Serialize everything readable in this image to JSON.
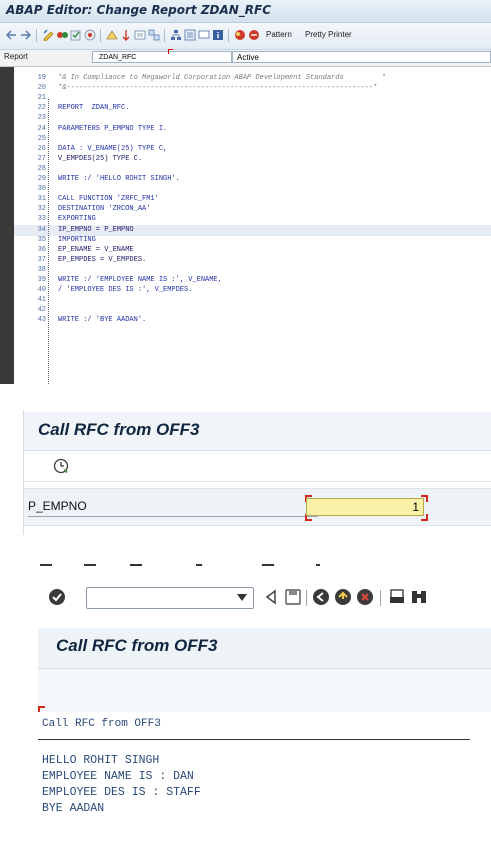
{
  "editor": {
    "title": "ABAP Editor: Change Report ZDAN_RFC",
    "toolbar": {
      "pattern_label": "Pattern",
      "pretty_printer_label": "Pretty Printer"
    },
    "report_label": "Report",
    "report_value": "ZDAN_RFC",
    "status": "Active",
    "lines": [
      {
        "no": "19",
        "text": "*& In Compliance to Megaworld Corporation ABAP Development Standards         *",
        "cls": "c-cmt"
      },
      {
        "no": "20",
        "text": "*&-------------------------------------------------------------------------*",
        "cls": "c-cmt"
      },
      {
        "no": "21",
        "text": "",
        "cls": ""
      },
      {
        "no": "22",
        "text": "REPORT  ZDAN_RFC.",
        "cls": "c-kw"
      },
      {
        "no": "23",
        "text": "",
        "cls": ""
      },
      {
        "no": "24",
        "text": "PARAMETERS P_EMPNO TYPE I.",
        "cls": "c-kw"
      },
      {
        "no": "25",
        "text": "",
        "cls": ""
      },
      {
        "no": "26",
        "text": "DATA : V_ENAME(25) TYPE C,",
        "cls": "c-kw"
      },
      {
        "no": "27",
        "text": "V_EMPDES(25) TYPE C.",
        "cls": "c-id"
      },
      {
        "no": "28",
        "text": "",
        "cls": ""
      },
      {
        "no": "29",
        "text": "WRITE :/ 'HELLO ROHIT SINGH'.",
        "cls": "c-kw"
      },
      {
        "no": "30",
        "text": "",
        "cls": ""
      },
      {
        "no": "31",
        "text": "CALL FUNCTION 'ZRFC_FM1'",
        "cls": "c-kw"
      },
      {
        "no": "32",
        "text": "DESTINATION 'ZRCON_AA'",
        "cls": "c-kw"
      },
      {
        "no": "33",
        "text": "EXPORTING",
        "cls": "c-kw"
      },
      {
        "no": "34",
        "text": "IP_EMPNO = P_EMPNO",
        "cls": "c-id"
      },
      {
        "no": "35",
        "text": "IMPORTING",
        "cls": "c-kw"
      },
      {
        "no": "36",
        "text": "EP_ENAME = V_ENAME",
        "cls": "c-id"
      },
      {
        "no": "37",
        "text": "EP_EMPDES = V_EMPDES.",
        "cls": "c-id"
      },
      {
        "no": "38",
        "text": "",
        "cls": ""
      },
      {
        "no": "39",
        "text": "WRITE :/ 'EMPLOYEE NAME IS :', V_ENAME,",
        "cls": "c-kw"
      },
      {
        "no": "40",
        "text": "/ 'EMPLOYEE DES IS :', V_EMPDES.",
        "cls": "c-kw"
      },
      {
        "no": "41",
        "text": "",
        "cls": ""
      },
      {
        "no": "42",
        "text": "",
        "cls": ""
      },
      {
        "no": "43",
        "text": "WRITE :/ 'BYE AADAN'.",
        "cls": "c-kw"
      }
    ]
  },
  "selection": {
    "title": "Call RFC from OFF3",
    "param_label": "P_EMPNO",
    "param_value": "1"
  },
  "output": {
    "title": "Call RFC from OFF3",
    "list_header": "Call RFC from OFF3",
    "lines": [
      "HELLO ROHIT SINGH",
      "EMPLOYEE NAME IS : DAN",
      "EMPLOYEE DES IS : STAFF",
      "BYE AADAN"
    ]
  },
  "colors": {
    "accent": "#0f2540",
    "input_bg": "#fbf0a8",
    "required_marker": "#d12a1c"
  }
}
